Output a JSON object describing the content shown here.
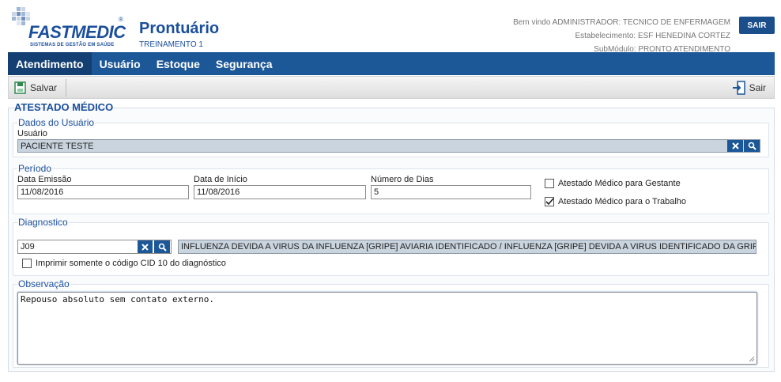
{
  "header": {
    "logo_text": "FASTMEDIC",
    "logo_reg": "®",
    "logo_tagline": "SISTEMAS DE GESTÃO EM SAÚDE",
    "title": "Prontuário",
    "subtitle": "TREINAMENTO 1",
    "welcome": "Bem vindo ADMINISTRADOR: TECNICO DE ENFERMAGEM",
    "establishment": "Estabelecimento: ESF HENEDINA CORTEZ",
    "submodule": "SubMódulo: PRONTO ATENDIMENTO",
    "exit_label": "SAIR"
  },
  "menu": {
    "items": [
      {
        "label": "Atendimento"
      },
      {
        "label": "Usuário"
      },
      {
        "label": "Estoque"
      },
      {
        "label": "Segurança"
      }
    ]
  },
  "toolbar": {
    "save_label": "Salvar",
    "exit_label": "Sair"
  },
  "form": {
    "title": "ATESTADO MÉDICO",
    "usuario_section": {
      "legend": "Dados do Usuário",
      "label": "Usuário",
      "value": "PACIENTE TESTE"
    },
    "periodo": {
      "legend": "Período",
      "data_emissao_label": "Data Emissão",
      "data_emissao": "11/08/2016",
      "data_inicio_label": "Data de Início",
      "data_inicio": "11/08/2016",
      "numero_dias_label": "Número de Dias",
      "numero_dias": "5",
      "gestante_label": "Atestado Médico para Gestante",
      "gestante_checked": false,
      "trabalho_label": "Atestado Médico para o Trabalho",
      "trabalho_checked": true
    },
    "diagnostico": {
      "legend": "Diagnostico",
      "cid_code": "J09",
      "cid_description": "INFLUENZA DEVIDA A VIRUS DA INFLUENZA [GRIPE] AVIARIA IDENTIFICADO / INFLUENZA [GRIPE] DEVIDA A VIRUS IDENTIFICADO DA GRIPE AVIARIA",
      "print_cid_label": "Imprimir somente o código CID 10 do diagnóstico",
      "print_cid_checked": false
    },
    "observacao": {
      "legend": "Observação",
      "text": "Repouso absoluto sem contato externo."
    }
  },
  "colors": {
    "brand": "#1b4f9c",
    "menu_bg": "#1c5797",
    "menu_active": "#133f72"
  }
}
